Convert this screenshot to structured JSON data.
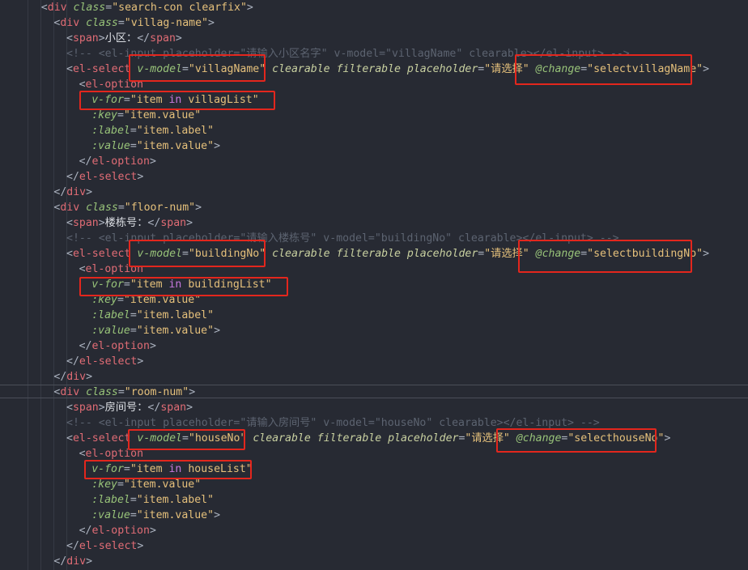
{
  "code_lines": [
    {
      "indent": 3,
      "tokens": [
        {
          "c": "p",
          "t": "<"
        },
        {
          "c": "tag",
          "t": "div"
        },
        {
          "c": "p",
          "t": " "
        },
        {
          "c": "attr-i",
          "t": "class"
        },
        {
          "c": "p",
          "t": "="
        },
        {
          "c": "str",
          "t": "\"search-con clearfix\""
        },
        {
          "c": "p",
          "t": ">"
        }
      ]
    },
    {
      "indent": 4,
      "tokens": [
        {
          "c": "p",
          "t": "<"
        },
        {
          "c": "tag",
          "t": "div"
        },
        {
          "c": "p",
          "t": " "
        },
        {
          "c": "attr-i",
          "t": "class"
        },
        {
          "c": "p",
          "t": "="
        },
        {
          "c": "str",
          "t": "\"villag-name\""
        },
        {
          "c": "p",
          "t": ">"
        }
      ]
    },
    {
      "indent": 5,
      "tokens": [
        {
          "c": "p",
          "t": "<"
        },
        {
          "c": "tag",
          "t": "span"
        },
        {
          "c": "p",
          "t": ">"
        },
        {
          "c": "txt",
          "t": "小区："
        },
        {
          "c": "p",
          "t": "</"
        },
        {
          "c": "tag",
          "t": "span"
        },
        {
          "c": "p",
          "t": ">"
        }
      ]
    },
    {
      "indent": 5,
      "tokens": [
        {
          "c": "cmt",
          "t": "<!-- <el-input placeholder=\"请输入小区名字\" v-model=\"villagName\" clearable></el-input> -->"
        }
      ]
    },
    {
      "indent": 5,
      "tokens": [
        {
          "c": "p",
          "t": "<"
        },
        {
          "c": "tag",
          "t": "el-select"
        },
        {
          "c": "p",
          "t": " "
        },
        {
          "c": "attr-i",
          "t": "v-model"
        },
        {
          "c": "p",
          "t": "="
        },
        {
          "c": "str",
          "t": "\"villagName\""
        },
        {
          "c": "p",
          "t": " "
        },
        {
          "c": "attr",
          "t": "clearable"
        },
        {
          "c": "p",
          "t": " "
        },
        {
          "c": "attr",
          "t": "filterable"
        },
        {
          "c": "p",
          "t": " "
        },
        {
          "c": "attr",
          "t": "placeholder"
        },
        {
          "c": "p",
          "t": "="
        },
        {
          "c": "str",
          "t": "\"请选择\""
        },
        {
          "c": "p",
          "t": " "
        },
        {
          "c": "attr-i",
          "t": "@change"
        },
        {
          "c": "p",
          "t": "="
        },
        {
          "c": "str",
          "t": "\"selectvillagName\""
        },
        {
          "c": "p",
          "t": ">"
        }
      ]
    },
    {
      "indent": 6,
      "tokens": [
        {
          "c": "p",
          "t": "<"
        },
        {
          "c": "tag",
          "t": "el-option"
        }
      ]
    },
    {
      "indent": 7,
      "tokens": [
        {
          "c": "attr-i",
          "t": "v-for"
        },
        {
          "c": "p",
          "t": "="
        },
        {
          "c": "str",
          "t": "\"item "
        },
        {
          "c": "kw",
          "t": "in"
        },
        {
          "c": "str",
          "t": " villagList\""
        }
      ]
    },
    {
      "indent": 7,
      "tokens": [
        {
          "c": "attr-i",
          "t": ":key"
        },
        {
          "c": "p",
          "t": "="
        },
        {
          "c": "str",
          "t": "\"item.value\""
        }
      ]
    },
    {
      "indent": 7,
      "tokens": [
        {
          "c": "attr-i",
          "t": ":label"
        },
        {
          "c": "p",
          "t": "="
        },
        {
          "c": "str",
          "t": "\"item.label\""
        }
      ]
    },
    {
      "indent": 7,
      "tokens": [
        {
          "c": "attr-i",
          "t": ":value"
        },
        {
          "c": "p",
          "t": "="
        },
        {
          "c": "str",
          "t": "\"item.value\""
        },
        {
          "c": "p",
          "t": ">"
        }
      ]
    },
    {
      "indent": 6,
      "tokens": [
        {
          "c": "p",
          "t": "</"
        },
        {
          "c": "tag",
          "t": "el-option"
        },
        {
          "c": "p",
          "t": ">"
        }
      ]
    },
    {
      "indent": 5,
      "tokens": [
        {
          "c": "p",
          "t": "</"
        },
        {
          "c": "tag",
          "t": "el-select"
        },
        {
          "c": "p",
          "t": ">"
        }
      ]
    },
    {
      "indent": 4,
      "tokens": [
        {
          "c": "p",
          "t": "</"
        },
        {
          "c": "tag",
          "t": "div"
        },
        {
          "c": "p",
          "t": ">"
        }
      ]
    },
    {
      "indent": 4,
      "tokens": [
        {
          "c": "p",
          "t": "<"
        },
        {
          "c": "tag",
          "t": "div"
        },
        {
          "c": "p",
          "t": " "
        },
        {
          "c": "attr-i",
          "t": "class"
        },
        {
          "c": "p",
          "t": "="
        },
        {
          "c": "str",
          "t": "\"floor-num\""
        },
        {
          "c": "p",
          "t": ">"
        }
      ]
    },
    {
      "indent": 5,
      "tokens": [
        {
          "c": "p",
          "t": "<"
        },
        {
          "c": "tag",
          "t": "span"
        },
        {
          "c": "p",
          "t": ">"
        },
        {
          "c": "txt",
          "t": "楼栋号："
        },
        {
          "c": "p",
          "t": "</"
        },
        {
          "c": "tag",
          "t": "span"
        },
        {
          "c": "p",
          "t": ">"
        }
      ]
    },
    {
      "indent": 5,
      "tokens": [
        {
          "c": "cmt",
          "t": "<!-- <el-input placeholder=\"请输入楼栋号\" v-model=\"buildingNo\" clearable></el-input> -->"
        }
      ]
    },
    {
      "indent": 5,
      "tokens": [
        {
          "c": "p",
          "t": "<"
        },
        {
          "c": "tag",
          "t": "el-select"
        },
        {
          "c": "p",
          "t": " "
        },
        {
          "c": "attr-i",
          "t": "v-model"
        },
        {
          "c": "p",
          "t": "="
        },
        {
          "c": "str",
          "t": "\"buildingNo\""
        },
        {
          "c": "p",
          "t": " "
        },
        {
          "c": "attr",
          "t": "clearable"
        },
        {
          "c": "p",
          "t": " "
        },
        {
          "c": "attr",
          "t": "filterable"
        },
        {
          "c": "p",
          "t": " "
        },
        {
          "c": "attr",
          "t": "placeholder"
        },
        {
          "c": "p",
          "t": "="
        },
        {
          "c": "str",
          "t": "\"请选择\""
        },
        {
          "c": "p",
          "t": " "
        },
        {
          "c": "attr-i",
          "t": "@change"
        },
        {
          "c": "p",
          "t": "="
        },
        {
          "c": "str",
          "t": "\"selectbuildingNo\""
        },
        {
          "c": "p",
          "t": ">"
        }
      ]
    },
    {
      "indent": 6,
      "tokens": [
        {
          "c": "p",
          "t": "<"
        },
        {
          "c": "tag",
          "t": "el-option"
        }
      ]
    },
    {
      "indent": 7,
      "tokens": [
        {
          "c": "attr-i",
          "t": "v-for"
        },
        {
          "c": "p",
          "t": "="
        },
        {
          "c": "str",
          "t": "\"item "
        },
        {
          "c": "kw",
          "t": "in"
        },
        {
          "c": "str",
          "t": " buildingList\""
        }
      ]
    },
    {
      "indent": 7,
      "tokens": [
        {
          "c": "attr-i",
          "t": ":key"
        },
        {
          "c": "p",
          "t": "="
        },
        {
          "c": "str",
          "t": "\"item.value\""
        }
      ]
    },
    {
      "indent": 7,
      "tokens": [
        {
          "c": "attr-i",
          "t": ":label"
        },
        {
          "c": "p",
          "t": "="
        },
        {
          "c": "str",
          "t": "\"item.label\""
        }
      ]
    },
    {
      "indent": 7,
      "tokens": [
        {
          "c": "attr-i",
          "t": ":value"
        },
        {
          "c": "p",
          "t": "="
        },
        {
          "c": "str",
          "t": "\"item.value\""
        },
        {
          "c": "p",
          "t": ">"
        }
      ]
    },
    {
      "indent": 6,
      "tokens": [
        {
          "c": "p",
          "t": "</"
        },
        {
          "c": "tag",
          "t": "el-option"
        },
        {
          "c": "p",
          "t": ">"
        }
      ]
    },
    {
      "indent": 5,
      "tokens": [
        {
          "c": "p",
          "t": "</"
        },
        {
          "c": "tag",
          "t": "el-select"
        },
        {
          "c": "p",
          "t": ">"
        }
      ]
    },
    {
      "indent": 4,
      "tokens": [
        {
          "c": "p",
          "t": "</"
        },
        {
          "c": "tag",
          "t": "div"
        },
        {
          "c": "p",
          "t": ">"
        }
      ]
    },
    {
      "indent": 4,
      "cursor": true,
      "tokens": [
        {
          "c": "p",
          "t": "<"
        },
        {
          "c": "tag",
          "t": "div"
        },
        {
          "c": "p",
          "t": " "
        },
        {
          "c": "attr-i",
          "t": "class"
        },
        {
          "c": "p",
          "t": "="
        },
        {
          "c": "str",
          "t": "\"room-num\""
        },
        {
          "c": "p",
          "t": ">"
        }
      ]
    },
    {
      "indent": 5,
      "tokens": [
        {
          "c": "p",
          "t": "<"
        },
        {
          "c": "tag",
          "t": "span"
        },
        {
          "c": "p",
          "t": ">"
        },
        {
          "c": "txt",
          "t": "房间号："
        },
        {
          "c": "p",
          "t": "</"
        },
        {
          "c": "tag",
          "t": "span"
        },
        {
          "c": "p",
          "t": ">"
        }
      ]
    },
    {
      "indent": 5,
      "tokens": [
        {
          "c": "cmt",
          "t": "<!-- <el-input placeholder=\"请输入房间号\" v-model=\"houseNo\" clearable></el-input> -->"
        }
      ]
    },
    {
      "indent": 5,
      "tokens": [
        {
          "c": "p",
          "t": "<"
        },
        {
          "c": "tag",
          "t": "el-select"
        },
        {
          "c": "p",
          "t": " "
        },
        {
          "c": "attr-i",
          "t": "v-model"
        },
        {
          "c": "p",
          "t": "="
        },
        {
          "c": "str",
          "t": "\"houseNo\""
        },
        {
          "c": "p",
          "t": " "
        },
        {
          "c": "attr",
          "t": "clearable"
        },
        {
          "c": "p",
          "t": " "
        },
        {
          "c": "attr",
          "t": "filterable"
        },
        {
          "c": "p",
          "t": " "
        },
        {
          "c": "attr",
          "t": "placeholder"
        },
        {
          "c": "p",
          "t": "="
        },
        {
          "c": "str",
          "t": "\"请选择\""
        },
        {
          "c": "p",
          "t": " "
        },
        {
          "c": "attr-i",
          "t": "@change"
        },
        {
          "c": "p",
          "t": "="
        },
        {
          "c": "str",
          "t": "\"selecthouseNo\""
        },
        {
          "c": "p",
          "t": ">"
        }
      ]
    },
    {
      "indent": 6,
      "tokens": [
        {
          "c": "p",
          "t": "<"
        },
        {
          "c": "tag",
          "t": "el-option"
        }
      ]
    },
    {
      "indent": 7,
      "tokens": [
        {
          "c": "attr-i",
          "t": "v-for"
        },
        {
          "c": "p",
          "t": "="
        },
        {
          "c": "str",
          "t": "\"item "
        },
        {
          "c": "kw",
          "t": "in"
        },
        {
          "c": "str",
          "t": " houseList\""
        }
      ]
    },
    {
      "indent": 7,
      "tokens": [
        {
          "c": "attr-i",
          "t": ":key"
        },
        {
          "c": "p",
          "t": "="
        },
        {
          "c": "str",
          "t": "\"item.value\""
        }
      ]
    },
    {
      "indent": 7,
      "tokens": [
        {
          "c": "attr-i",
          "t": ":label"
        },
        {
          "c": "p",
          "t": "="
        },
        {
          "c": "str",
          "t": "\"item.label\""
        }
      ]
    },
    {
      "indent": 7,
      "tokens": [
        {
          "c": "attr-i",
          "t": ":value"
        },
        {
          "c": "p",
          "t": "="
        },
        {
          "c": "str",
          "t": "\"item.value\""
        },
        {
          "c": "p",
          "t": ">"
        }
      ]
    },
    {
      "indent": 6,
      "tokens": [
        {
          "c": "p",
          "t": "</"
        },
        {
          "c": "tag",
          "t": "el-option"
        },
        {
          "c": "p",
          "t": ">"
        }
      ]
    },
    {
      "indent": 5,
      "tokens": [
        {
          "c": "p",
          "t": "</"
        },
        {
          "c": "tag",
          "t": "el-select"
        },
        {
          "c": "p",
          "t": ">"
        }
      ]
    },
    {
      "indent": 4,
      "tokens": [
        {
          "c": "p",
          "t": "</"
        },
        {
          "c": "tag",
          "t": "div"
        },
        {
          "c": "p",
          "t": ">"
        }
      ]
    }
  ],
  "colors": {
    "background": "#272a33",
    "highlight_box": "#e3261d"
  }
}
